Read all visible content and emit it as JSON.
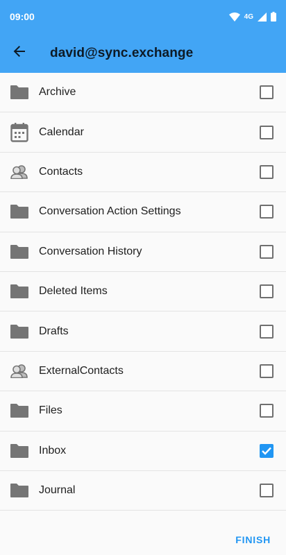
{
  "status": {
    "time": "09:00",
    "network": "4G"
  },
  "toolbar": {
    "title": "david@sync.exchange"
  },
  "folders": [
    {
      "label": "Archive",
      "icon": "folder-icon",
      "checked": false
    },
    {
      "label": "Calendar",
      "icon": "calendar-icon",
      "checked": false
    },
    {
      "label": "Contacts",
      "icon": "contacts-icon",
      "checked": false
    },
    {
      "label": "Conversation Action Settings",
      "icon": "folder-icon",
      "checked": false
    },
    {
      "label": "Conversation History",
      "icon": "folder-icon",
      "checked": false
    },
    {
      "label": "Deleted Items",
      "icon": "folder-icon",
      "checked": false
    },
    {
      "label": "Drafts",
      "icon": "folder-icon",
      "checked": false
    },
    {
      "label": "ExternalContacts",
      "icon": "contacts-icon",
      "checked": false
    },
    {
      "label": "Files",
      "icon": "folder-icon",
      "checked": false
    },
    {
      "label": "Inbox",
      "icon": "folder-icon",
      "checked": true
    },
    {
      "label": "Journal",
      "icon": "folder-icon",
      "checked": false
    }
  ],
  "actions": {
    "finish_label": "FINISH"
  },
  "colors": {
    "appbar": "#42a5f5",
    "accent": "#2196f3",
    "icon": "#757575"
  }
}
